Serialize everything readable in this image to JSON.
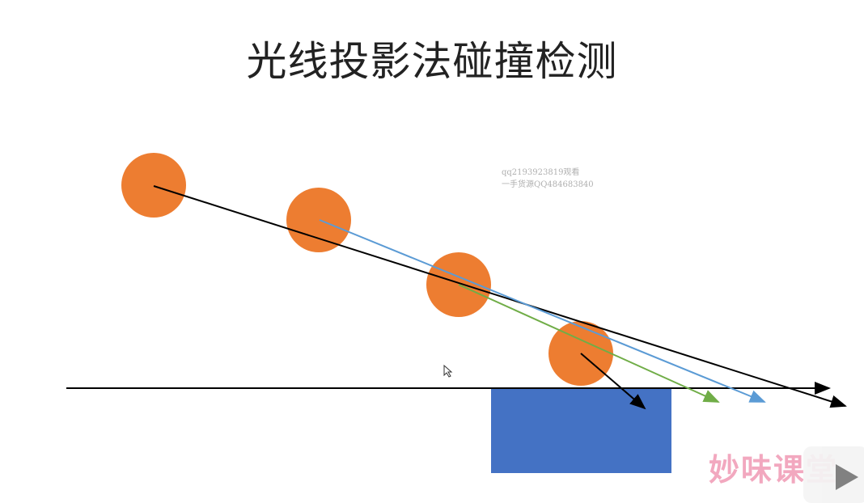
{
  "title": "光线投影法碰撞检测",
  "watermark": {
    "line1": "qq2193923819观看",
    "line2": "一手货源QQ484683840"
  },
  "logo": {
    "text": "妙味课堂"
  },
  "colors": {
    "ball": "#ed7d31",
    "block": "#4472c4",
    "ray_black": "#000000",
    "ray_blue": "#5b9bd5",
    "ray_green": "#70ad47"
  }
}
